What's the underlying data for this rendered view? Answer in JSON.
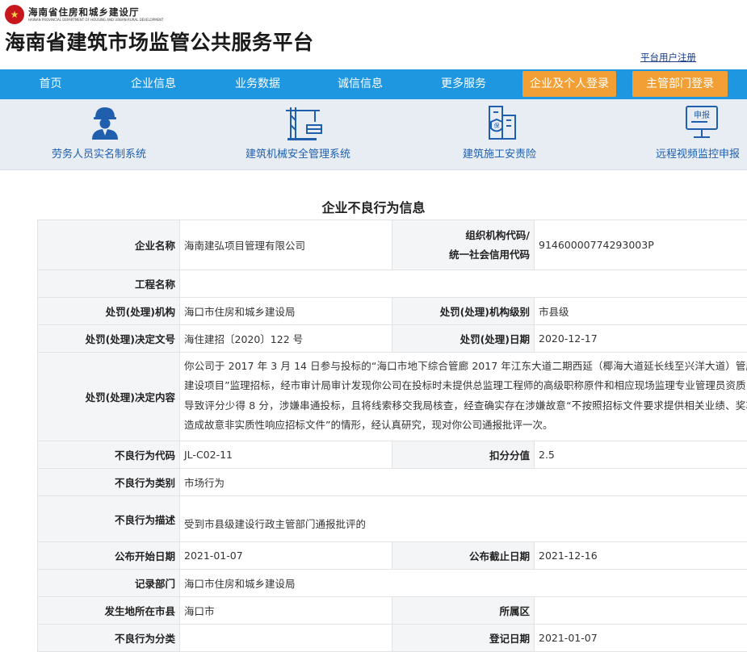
{
  "header": {
    "dept_name": "海南省住房和城乡建设厅",
    "dept_name_en": "HAINAN PROVINCIAL DEPARTMENT OF HOUSING AND URBAN-RURAL DEVELOPMENT",
    "site_title": "海南省建筑市场监管公共服务平台",
    "register_link": "平台用户注册"
  },
  "nav": {
    "items": [
      "首页",
      "企业信息",
      "业务数据",
      "诚信信息",
      "更多服务"
    ],
    "login_company": "企业及个人登录",
    "login_admin": "主管部门登录"
  },
  "systems": [
    {
      "label": "劳务人员实名制系统",
      "icon": "worker-icon"
    },
    {
      "label": "建筑机械安全管理系统",
      "icon": "crane-icon"
    },
    {
      "label": "建筑施工安责险",
      "icon": "insurance-building-icon"
    },
    {
      "label": "远程视频监控申报",
      "icon": "monitor-report-icon"
    }
  ],
  "page_heading": "企业不良行为信息",
  "record": {
    "company_name_label": "企业名称",
    "company_name": "海南建弘项目管理有限公司",
    "org_code_label_1": "组织机构代码/",
    "org_code_label_2": "统一社会信用代码",
    "org_code": "91460000774293003P",
    "project_name_label": "工程名称",
    "project_name": "",
    "penalty_org_label": "处罚(处理)机构",
    "penalty_org": "海口市住房和城乡建设局",
    "penalty_org_level_label": "处罚(处理)机构级别",
    "penalty_org_level": "市县级",
    "decision_no_label": "处罚(处理)决定文号",
    "decision_no": "海住建招〔2020〕122 号",
    "penalty_date_label": "处罚(处理)日期",
    "penalty_date": "2020-12-17",
    "decision_content_label": "处罚(处理)决定内容",
    "decision_content": "你公司于 2017 年 3 月 14 日参与投标的“海口市地下综合管廊 2017 年江东大道二期西延（椰海大道延长线至兴洋大道）管廊建设项目”监理招标，经市审计局审计发现你公司在投标时未提供总监理工程师的高级职称原件和相应现场监理专业管理员资质，导致评分少得 8 分，涉嫌串通投标，且将线索移交我局核查，经查确实存在涉嫌故意“不按照招标文件要求提供相关业绩、奖项造成故意非实质性响应招标文件”的情形，经认真研究，现对你公司通报批评一次。",
    "behavior_code_label": "不良行为代码",
    "behavior_code": "JL-C02-11",
    "deduct_score_label": "扣分分值",
    "deduct_score": "2.5",
    "behavior_category_label": "不良行为类别",
    "behavior_category": "市场行为",
    "behavior_desc_label": "不良行为描述",
    "behavior_desc": "受到市县级建设行政主管部门通报批评的",
    "publish_start_label": "公布开始日期",
    "publish_start": "2021-01-07",
    "publish_end_label": "公布截止日期",
    "publish_end": "2021-12-16",
    "record_dept_label": "记录部门",
    "record_dept": "海口市住房和城乡建设局",
    "city_label": "发生地所在市县",
    "city": "海口市",
    "district_label": "所属区",
    "district": "",
    "behavior_class_label": "不良行为分类",
    "behavior_class": "",
    "register_date_label": "登记日期",
    "register_date": "2021-01-07"
  },
  "colors": {
    "nav_blue": "#1f96e0",
    "login_orange": "#f2a035",
    "system_blue": "#1f5fae",
    "title_red": "#c8161d"
  }
}
